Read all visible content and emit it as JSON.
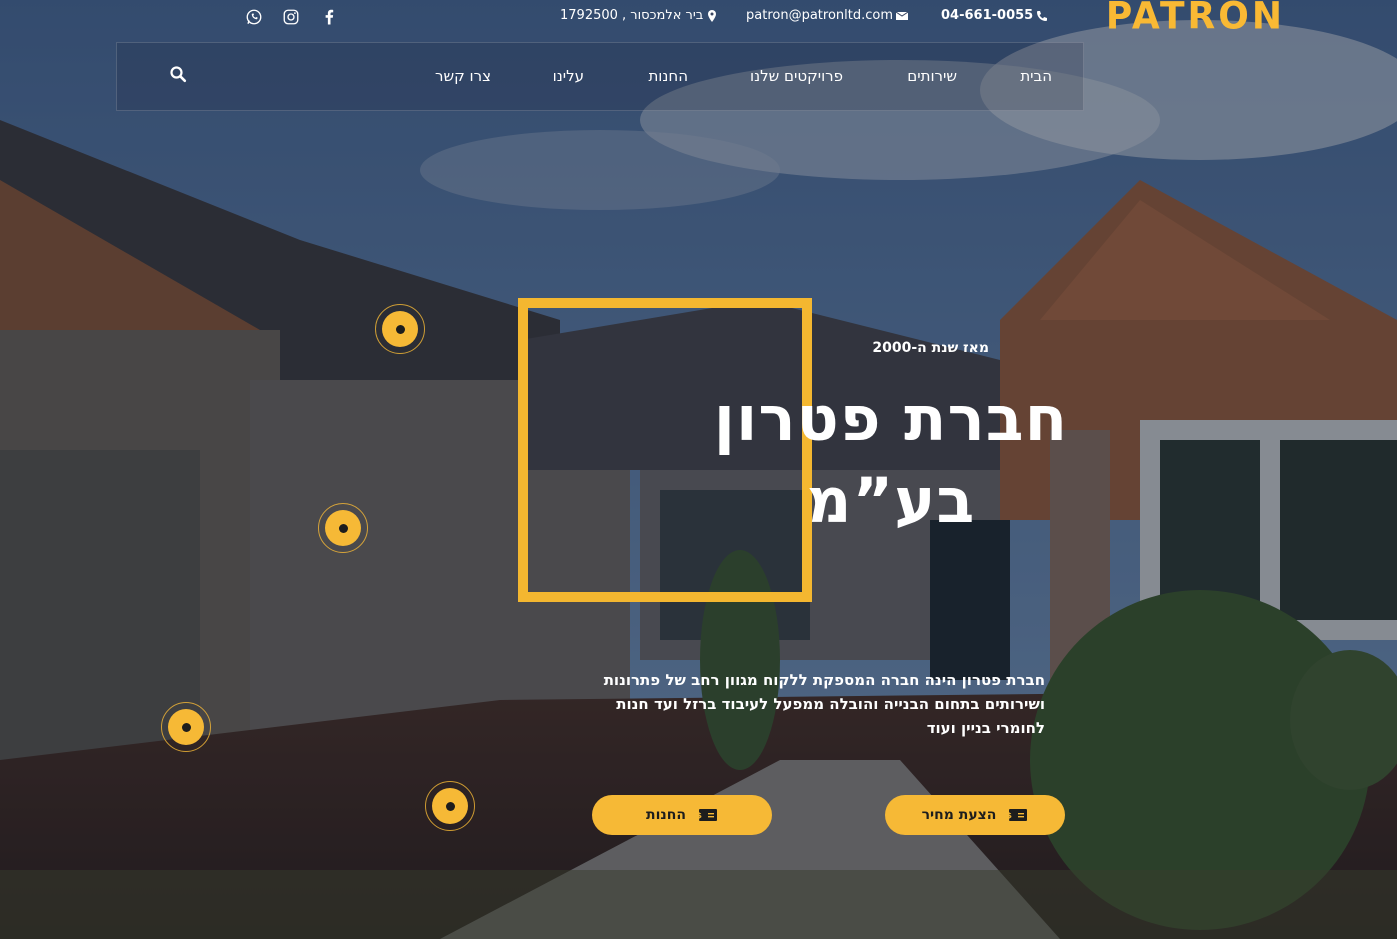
{
  "brand": {
    "logo_text": "PATRON",
    "accent": "#f6b936"
  },
  "topbar": {
    "phone": "04-661-0055",
    "email": "patron@patronltd.com",
    "address": "ביר אלמכסור , 1792500",
    "social": [
      "whatsapp-icon",
      "instagram-icon",
      "facebook-icon"
    ]
  },
  "nav": {
    "items": [
      "הבית",
      "שירותים",
      "פרויקטים שלנו",
      "החנות",
      "עלינו",
      "צרו קשר"
    ]
  },
  "hero": {
    "eyebrow": "מאז שנת ה-2000",
    "title_line1": "חברת פטרון",
    "title_line2": "בע”מ",
    "description": "חברת פטרון הינה חברה המספקת ללקוח מגוון רחב של פתרונות ושירותים בתחום הבנייה והובלה ממפעל לעיבוד ברזל ועד חנות לחומרי בניין ועוד",
    "buttons": {
      "quote": "הצעת מחיר",
      "store": "החנות"
    }
  }
}
